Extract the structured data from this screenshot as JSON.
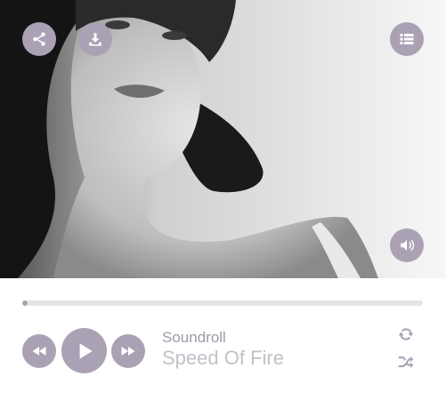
{
  "track": {
    "artist": "Soundroll",
    "title": "Speed Of Fire"
  },
  "progress": {
    "fraction": 0.01
  },
  "icons": {
    "share": "share-icon",
    "download": "download-icon",
    "playlist": "playlist-icon",
    "volume": "volume-icon",
    "previous": "backward-icon",
    "play": "play-icon",
    "next": "forward-icon",
    "repeat": "repeat-icon",
    "shuffle": "shuffle-icon"
  },
  "colors": {
    "accent": "#aaa2b4",
    "track_bg": "#e5e5e5",
    "artist_text": "#a09aa7",
    "title_text": "#c4c0c9"
  }
}
